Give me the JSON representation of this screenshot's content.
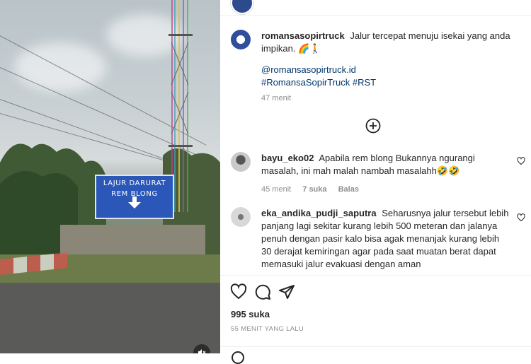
{
  "post": {
    "username": "romansasopirtruck",
    "caption": "Jalur tercepat menuju isekai yang anda impikan.",
    "caption_emojis": "🌈🚶",
    "mention": "@romansasopirtruck.id",
    "hashtags": "#RomansaSopirTruck #RST",
    "time": "47 menit"
  },
  "sign": {
    "line1": "LAJUR DARURAT",
    "line2": "REM BLONG"
  },
  "comments": [
    {
      "username": "bayu_eko02",
      "text": "Apabila rem blong Bukannya ngurangi masalah, ini mah malah nambah masalahh",
      "emojis": "🤣🤣",
      "time": "45 menit",
      "likes": "7 suka",
      "reply": "Balas"
    },
    {
      "username": "eka_andika_pudji_saputra",
      "text": "Seharusnya jalur tersebut lebih panjang lagi sekitar kurang lebih 500 meteran dan jalanya penuh dengan pasir kalo bisa agak menanjak kurang lebih 30 derajat kemiringan agar pada saat muatan berat dapat memasuki jalur evakuasi dengan aman"
    }
  ],
  "footer": {
    "likes": "995 suka",
    "posted": "55 MENIT YANG LALU"
  },
  "icons": {
    "like": "heart-icon",
    "comment": "comment-icon",
    "share": "share-icon",
    "load_more": "plus-circle-icon",
    "mute": "mute-icon"
  }
}
